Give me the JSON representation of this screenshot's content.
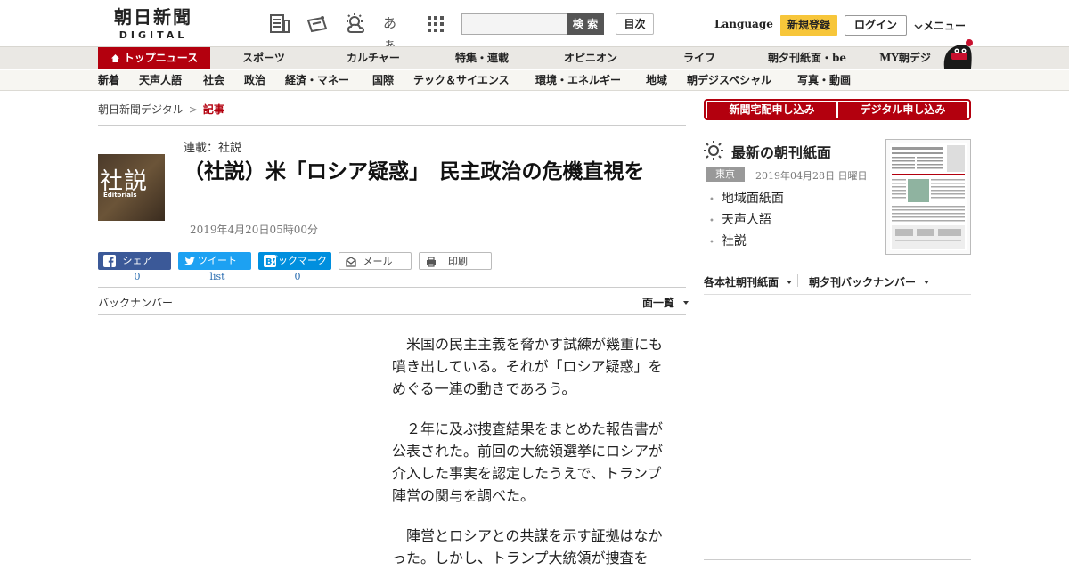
{
  "header": {
    "logo_ja": "朝日新聞",
    "logo_en": "DIGITAL",
    "search_button": "検 索",
    "contents_button": "目次",
    "language_link": "Language",
    "register_button": "新規登録",
    "login_button": "ログイン",
    "menu_button": "メニュー",
    "tool_icons": [
      "newspaper-icon",
      "coupon-icon",
      "weather-icon",
      "font-size-icon",
      "apps-grid-icon"
    ],
    "font_icon_text": "あぁ"
  },
  "nav_primary": {
    "items": [
      "トップニュース",
      "スポーツ",
      "カルチャー",
      "特集・連載",
      "オピニオン",
      "ライフ",
      "朝夕刊紙面・be",
      "MY朝デジ"
    ]
  },
  "nav_secondary": {
    "items": [
      "新着",
      "天声人語",
      "社会",
      "政治",
      "経済・マネー",
      "国際",
      "テック＆サイエンス",
      "環境・エネルギー",
      "地域",
      "朝デジスペシャル",
      "写真・動画"
    ]
  },
  "breadcrumb": {
    "home": "朝日新聞デジタル",
    "separator": ">",
    "current": "記事"
  },
  "article": {
    "thumb_ja": "社説",
    "thumb_en": "Editorials",
    "series": "連載：社説",
    "title": "（社説）米「ロシア疑惑」　民主政治の危機直視を",
    "date": "2019年4月20日05時00分",
    "paragraphs": [
      "米国の民主主義を脅かす試練が幾重にも噴き出している。それが「ロシア疑惑」をめぐる一連の動きであろう。",
      "２年に及ぶ捜査結果をまとめた報告書が公表された。前回の大統領選挙にロシアが介入した事実を認定したうえで、トランプ陣営の関与を調べた。",
      "陣営とロシアとの共謀を示す証拠はなかった。しかし、トランプ大統領が捜査を"
    ]
  },
  "share": {
    "facebook_label": "シェア",
    "facebook_count": "0",
    "twitter_label": "ツイート",
    "twitter_count": "list",
    "hatena_label": "ブックマーク",
    "hatena_count": "0",
    "mail_label": "メール",
    "print_label": "印刷"
  },
  "back_numbers": {
    "label": "バックナンバー",
    "list_toggle": "面一覧"
  },
  "sidebar": {
    "subscribe_paper": "新聞宅配申し込み",
    "subscribe_digital": "デジタル申し込み",
    "latest_title": "最新の朝刊紙面",
    "region": "東京",
    "paper_date": "2019年04月28日 日曜日",
    "paper_links": [
      "地域面紙面",
      "天声人語",
      "社説"
    ],
    "link_regional": "各本社朝刊紙面",
    "link_backnumbers": "朝夕刊バックナンバー"
  },
  "colors": {
    "brand_red": "#b3000e",
    "register_yellow": "#f7c63a",
    "facebook": "#3b5998",
    "twitter": "#1da1f2",
    "hatena": "#008fde"
  }
}
